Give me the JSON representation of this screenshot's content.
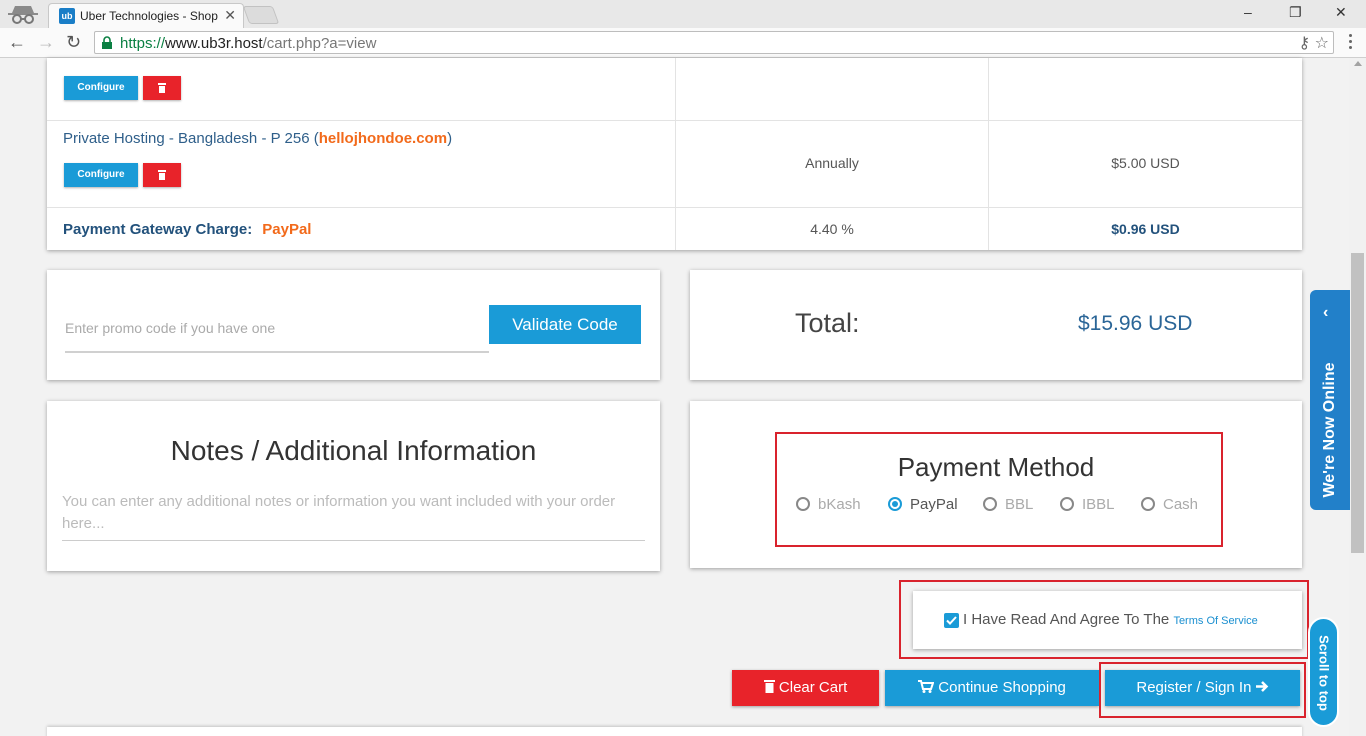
{
  "browser": {
    "tab_title": "Uber Technologies - Shop",
    "tab_favicon": "ub",
    "url_scheme": "https://",
    "url_host": "www.ub3r.host",
    "url_path": "/cart.php?a=view",
    "controls": {
      "minimize": "–",
      "maximize": "❐",
      "close": "✕",
      "tab_close": "✕"
    }
  },
  "cart": {
    "configure_label": "Configure",
    "items": [
      {
        "name": "Private Hosting - Bangladesh - P 256",
        "domain": "hellojhondoe.com",
        "cycle": "Annually",
        "price": "$5.00 USD"
      }
    ],
    "gateway": {
      "label": "Payment Gateway Charge:",
      "name": "PayPal",
      "rate": "4.40 %",
      "amount": "$0.96 USD"
    }
  },
  "promo": {
    "placeholder": "Enter promo code if you have one",
    "button": "Validate Code"
  },
  "total": {
    "label": "Total:",
    "value": "$15.96 USD"
  },
  "notes": {
    "title": "Notes / Additional Information",
    "placeholder": "You can enter any additional notes or information you want included with your order here..."
  },
  "payment": {
    "title": "Payment Method",
    "options": [
      "bKash",
      "PayPal",
      "BBL",
      "IBBL",
      "Cash"
    ],
    "selected": "PayPal"
  },
  "tos": {
    "text": "I Have Read And Agree To The",
    "link": "Terms Of Service"
  },
  "actions": {
    "clear": "Clear Cart",
    "continue": "Continue Shopping",
    "register": "Register / Sign In"
  },
  "widgets": {
    "online": "We're Now Online",
    "scroll_top": "Scroll to top"
  },
  "colors": {
    "primary": "#1a9bd7",
    "danger": "#e8232a",
    "accent": "#f26a1b",
    "highlight": "#d9232d"
  }
}
